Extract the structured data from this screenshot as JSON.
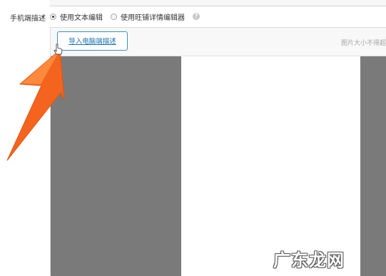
{
  "mobile_desc": {
    "label": "手机端描述",
    "options": [
      {
        "label": "使用文本编辑",
        "selected": true
      },
      {
        "label": "使用旺铺详情编辑器",
        "selected": false
      }
    ],
    "help_icon": "question-circle-icon"
  },
  "editor": {
    "import_button": "导入电脑端描述",
    "image_size_note": "图片大小不得超"
  },
  "annotation": {
    "arrow_color": "#f5641e",
    "arrow_icon": "pointer-arrow-icon",
    "cursor_icon": "hand-cursor-icon"
  },
  "watermark": {
    "text": "广东龙网"
  }
}
